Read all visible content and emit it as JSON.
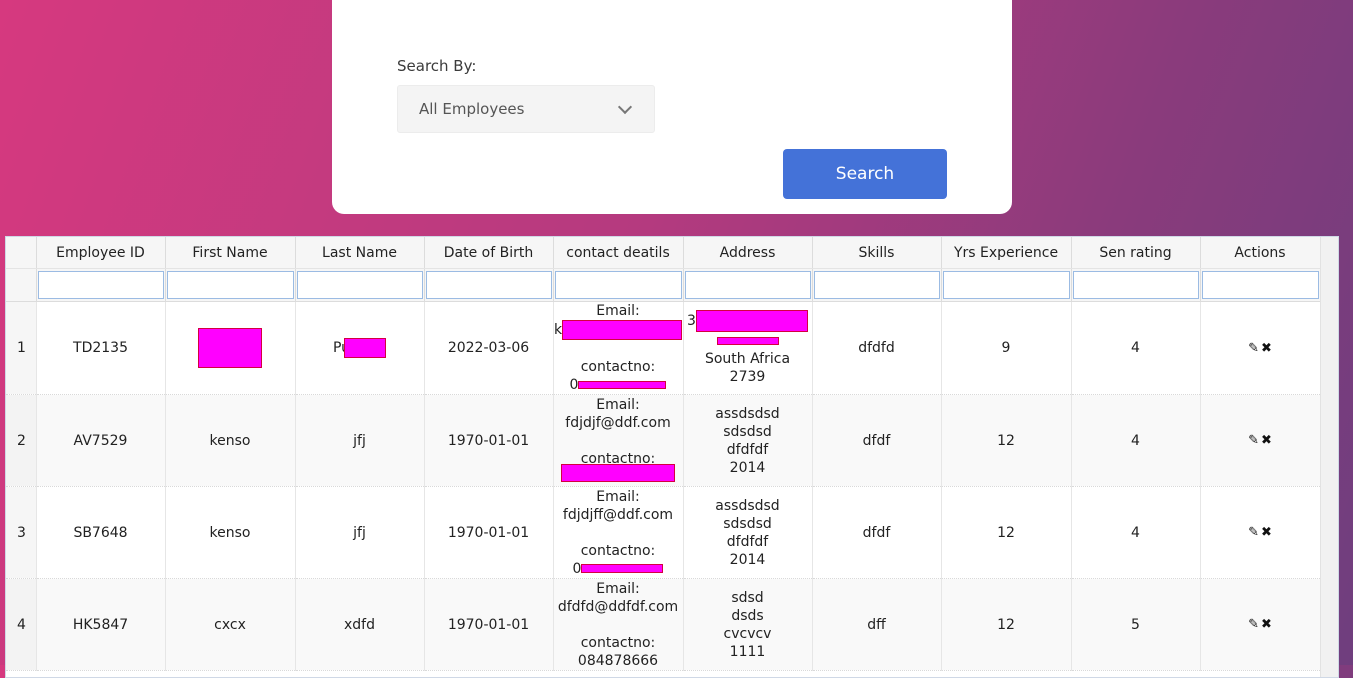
{
  "search": {
    "label": "Search By:",
    "selected": "All Employees",
    "button": "Search"
  },
  "table": {
    "columns": [
      "Employee ID",
      "First Name",
      "Last Name",
      "Date of Birth",
      "contact deatils",
      "Address",
      "Skills",
      "Yrs Experience",
      "Sen rating",
      "Actions"
    ],
    "rows": [
      {
        "num": "1",
        "id": "TD2135",
        "first": "",
        "last": "Pu",
        "dob": "2022-03-06",
        "email_label": "Email:",
        "email": "k",
        "contact_label": "contactno:",
        "contact": "0",
        "addr": [
          "3",
          "South Africa",
          "2739"
        ],
        "skills": "dfdfd",
        "yrs": "9",
        "rating": "4"
      },
      {
        "num": "2",
        "id": "AV7529",
        "first": "kenso",
        "last": "jfj",
        "dob": "1970-01-01",
        "email_label": "Email:",
        "email": "fdjdjf@ddf.com",
        "contact_label": "contactno:",
        "contact": "",
        "addr": [
          "assdsdsd",
          "sdsdsd",
          "dfdfdf",
          "2014"
        ],
        "skills": "dfdf",
        "yrs": "12",
        "rating": "4"
      },
      {
        "num": "3",
        "id": "SB7648",
        "first": "kenso",
        "last": "jfj",
        "dob": "1970-01-01",
        "email_label": "Email:",
        "email": "fdjdjff@ddf.com",
        "contact_label": "contactno:",
        "contact": "0",
        "addr": [
          "assdsdsd",
          "sdsdsd",
          "dfdfdf",
          "2014"
        ],
        "skills": "dfdf",
        "yrs": "12",
        "rating": "4"
      },
      {
        "num": "4",
        "id": "HK5847",
        "first": "cxcx",
        "last": "xdfd",
        "dob": "1970-01-01",
        "email_label": "Email:",
        "email": "dfdfd@ddfdf.com",
        "contact_label": "contactno:",
        "contact": "084878666",
        "addr": [
          "sdsd",
          "dsds",
          "cvcvcv",
          "1111"
        ],
        "skills": "dff",
        "yrs": "12",
        "rating": "5"
      }
    ]
  },
  "icons": {
    "edit": "pencil-icon",
    "delete": "close-icon"
  },
  "colors": {
    "accent": "#4472d8",
    "redaction": "#ff00ff"
  }
}
